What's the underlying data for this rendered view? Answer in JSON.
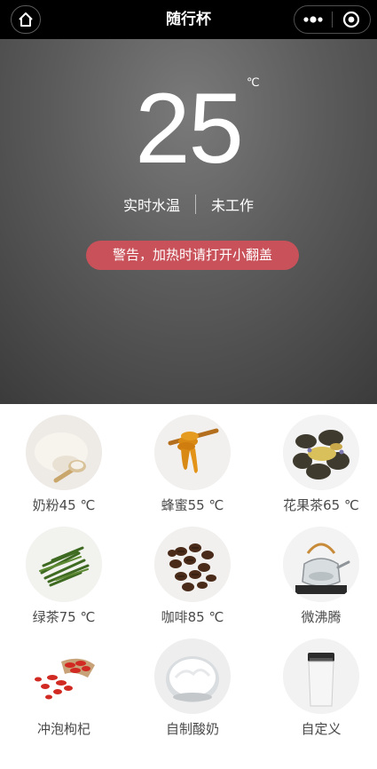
{
  "header": {
    "title": "随行杯",
    "home_icon": "home-icon",
    "more_icon": "more-dots-icon",
    "close_icon": "target-close-icon"
  },
  "hero": {
    "temperature": "25",
    "unit": "℃",
    "water_temp_label": "实时水温",
    "work_status": "未工作",
    "warning": "警告，加热时请打开小翻盖"
  },
  "presets": [
    {
      "label": "奶粉45 ℃",
      "icon": "milk-powder-icon"
    },
    {
      "label": "蜂蜜55 ℃",
      "icon": "honey-icon"
    },
    {
      "label": "花果茶65 ℃",
      "icon": "flower-tea-icon"
    },
    {
      "label": "绿茶75 ℃",
      "icon": "green-tea-icon"
    },
    {
      "label": "咖啡85 ℃",
      "icon": "coffee-beans-icon"
    },
    {
      "label": "微沸腾",
      "icon": "kettle-icon"
    },
    {
      "label": "冲泡枸杞",
      "icon": "goji-icon"
    },
    {
      "label": "自制酸奶",
      "icon": "yogurt-icon"
    },
    {
      "label": "自定义",
      "icon": "custom-cup-icon"
    }
  ]
}
